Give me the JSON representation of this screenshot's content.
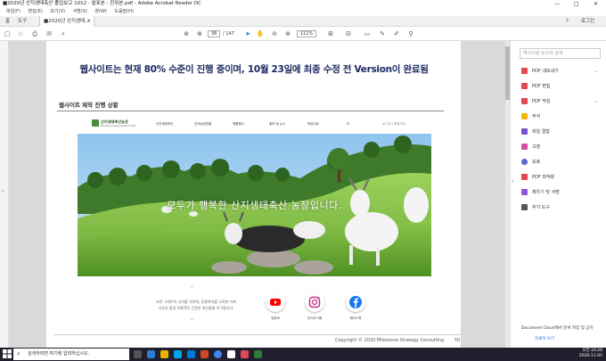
{
  "window": {
    "title": "■2020년 산지생태축산 졸업보고 1012 - 발표본 - 진위본.pdf - Adobe Acrobat Reader DC",
    "controls": [
      "—",
      "□",
      "✕"
    ]
  },
  "menu": [
    "파일(F)",
    "편집(E)",
    "보기(V)",
    "서명(S)",
    "창(W)",
    "도움말(H)"
  ],
  "tabs": {
    "home": "홈",
    "tools": "도구",
    "document": "■2020년 산지생태...",
    "help_icon": "?",
    "login": "로그인"
  },
  "toolbar": {
    "page_current": "38",
    "page_total": "/ 147",
    "zoom": "111%"
  },
  "document": {
    "headline": "웹사이트는 현재 80% 수준이 진행 중이며, 10월 23일에 최종 수정 전 Version이 완료됨",
    "section_title": "웹사이트 제작 진행 상황",
    "site": {
      "logo_text": "산지생태축산농장",
      "logo_sub": "Mountain Ecology Livestock Farm",
      "nav": [
        "산지생태축산",
        "전국농장현황",
        "체험행사",
        "홍보 및 뉴스",
        "학습자료"
      ],
      "login_links": "로그인 | 회원가입",
      "hero_text": "모두가 행복한 산지생태축산 농장입니다.",
      "quote_open": "“",
      "quote_close": "”",
      "quote_line1": "자연 그대로의 산지를 지키며, 동물복지를 고려한 가축",
      "quote_line2": "사육과 환경 친화적인 건강한 축산물을 추구합니다.",
      "social": [
        {
          "label": "유튜브",
          "color": "#ff0000"
        },
        {
          "label": "인스타그램",
          "color": "#c13584"
        },
        {
          "label": "페이스북",
          "color": "#1877f2"
        }
      ]
    },
    "footer": {
      "copyright": "Copyright © 2020 Milestone Strategy Consulting",
      "page_number": "50"
    }
  },
  "right_panel": {
    "search_placeholder": "역사기상 도구의 검색",
    "tools": [
      {
        "label": "PDF 내보내기",
        "color": "#e34850",
        "chevron": true
      },
      {
        "label": "PDF 편집",
        "color": "#e34850",
        "chevron": false
      },
      {
        "label": "PDF 작성",
        "color": "#e34850",
        "chevron": true
      },
      {
        "label": "주석",
        "color": "#f5b400",
        "chevron": false
      },
      {
        "label": "파일 결합",
        "color": "#7b4fd1",
        "chevron": false
      },
      {
        "label": "고정",
        "color": "#d04fa0",
        "chevron": false
      },
      {
        "label": "보호",
        "color": "#5a6ad6",
        "chevron": false
      },
      {
        "label": "PDF 최적화",
        "color": "#e34850",
        "chevron": false
      },
      {
        "label": "채우기 및 서명",
        "color": "#8a5cd6",
        "chevron": false
      },
      {
        "label": "추가 도구",
        "color": "#555555",
        "chevron": false
      }
    ],
    "dc_text": "Document Cloud에서 문서 저장 및 공유",
    "dc_link": "자세히 보기"
  },
  "taskbar": {
    "search_placeholder": "검색하려면 여기에 입력하십시오.",
    "time": "오전 10:28",
    "date": "2020-11-05"
  }
}
